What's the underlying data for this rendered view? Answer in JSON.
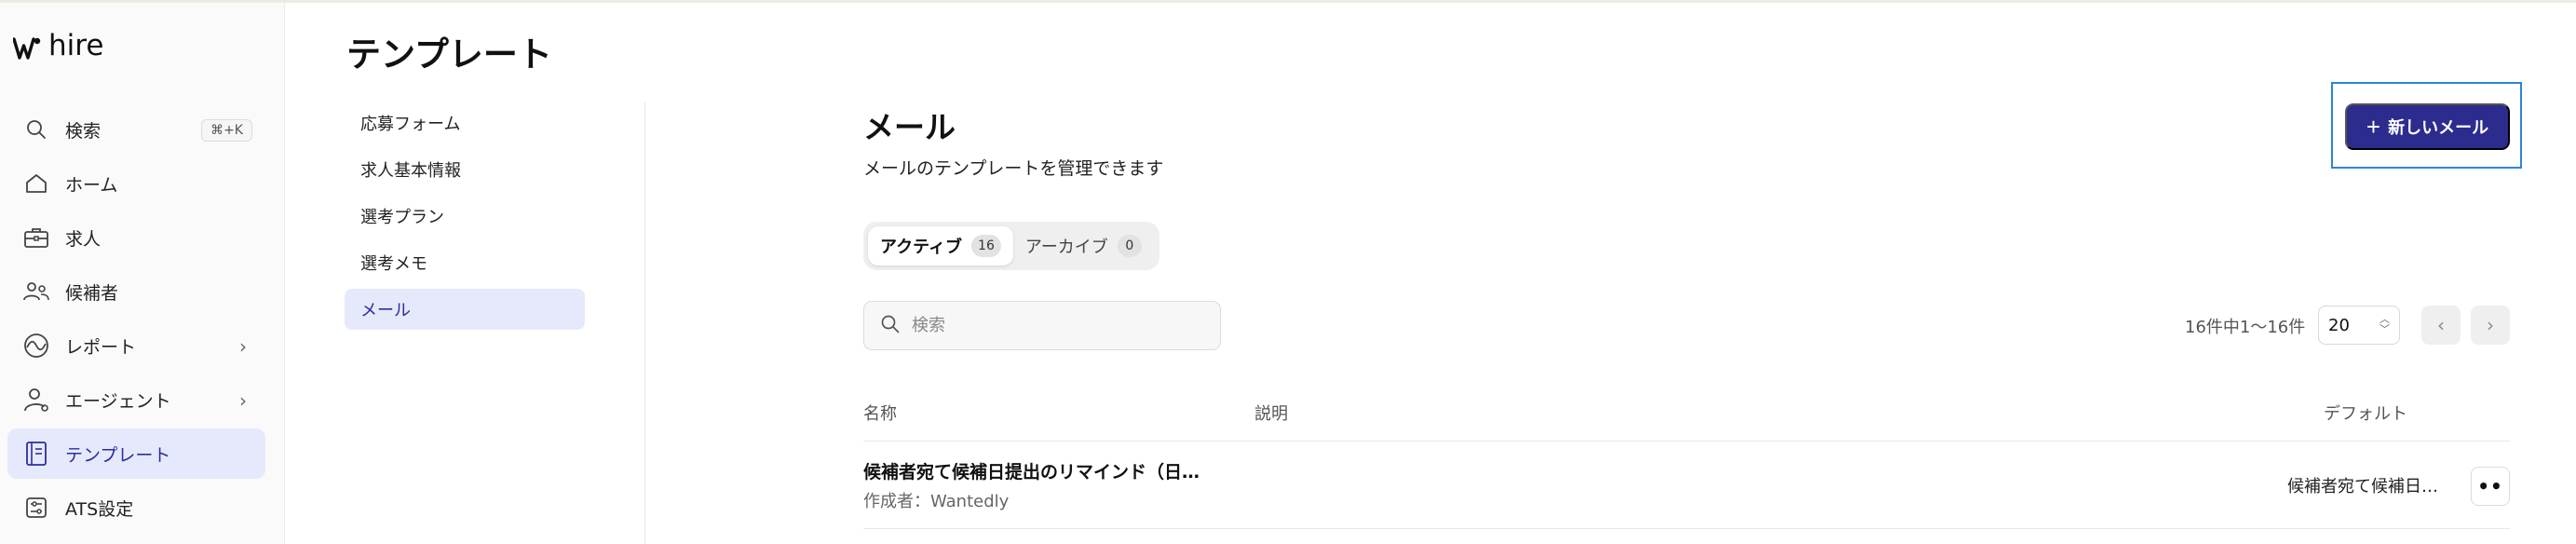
{
  "brand": {
    "name": "hire"
  },
  "sidebar": {
    "items": [
      {
        "label": "検索",
        "shortcut": "⌘+K",
        "icon": "search-icon"
      },
      {
        "label": "ホーム",
        "icon": "home-icon"
      },
      {
        "label": "求人",
        "icon": "briefcase-icon"
      },
      {
        "label": "候補者",
        "icon": "people-icon"
      },
      {
        "label": "レポート",
        "icon": "chart-icon",
        "chevron": "›"
      },
      {
        "label": "エージェント",
        "icon": "agent-icon",
        "chevron": "›"
      },
      {
        "label": "テンプレート",
        "icon": "template-icon",
        "active": true
      },
      {
        "label": "ATS設定",
        "icon": "settings-icon"
      }
    ]
  },
  "page": {
    "title": "テンプレート"
  },
  "subnav": {
    "items": [
      {
        "label": "応募フォーム"
      },
      {
        "label": "求人基本情報"
      },
      {
        "label": "選考プラン"
      },
      {
        "label": "選考メモ"
      },
      {
        "label": "メール",
        "active": true
      }
    ]
  },
  "main": {
    "title": "メール",
    "subtitle": "メールのテンプレートを管理できます",
    "new_button": {
      "icon": "+",
      "label": "新しいメール"
    },
    "tabs": [
      {
        "label": "アクティブ",
        "count": "16",
        "active": true
      },
      {
        "label": "アーカイブ",
        "count": "0"
      }
    ],
    "search": {
      "placeholder": "検索",
      "value": ""
    },
    "pagination": {
      "summary": "16件中1〜16件",
      "per_page": "20",
      "prev": "‹",
      "next": "›"
    },
    "table": {
      "columns": [
        "名称",
        "説明",
        "デフォルト"
      ],
      "rows": [
        {
          "name": "候補者宛て候補日提出のリマインド（日…",
          "author": "作成者：Wantedly",
          "description": "",
          "default": "候補者宛て候補日…",
          "more": "••"
        }
      ]
    }
  },
  "colors": {
    "accent": "#2c2c8f",
    "active_bg": "#e6e9fb",
    "focus_ring": "#2b86d6"
  }
}
